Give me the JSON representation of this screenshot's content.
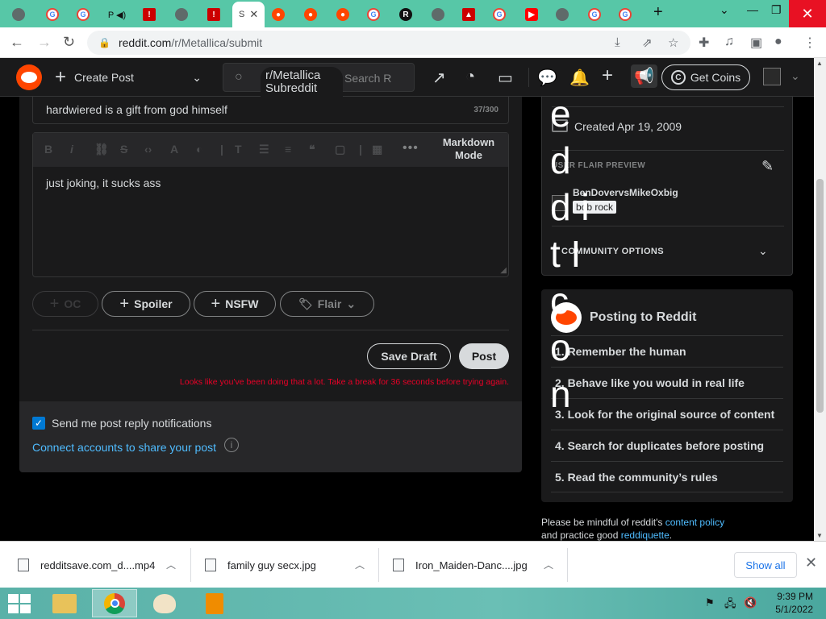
{
  "browser": {
    "active_tab_label": "S",
    "url_host": "reddit.com",
    "url_path": "/r/Metallica/submit",
    "tab_favicons": [
      "chrome-icon",
      "google-icon",
      "google-icon",
      "generic-icon",
      "youtube-dislike-icon",
      "chrome-icon",
      "youtube-dislike-icon",
      "reddit-icon",
      "reddit-icon",
      "reddit-icon",
      "google-icon",
      "rapidsave-icon",
      "chrome-icon",
      "reddit-dl-icon",
      "google-icon",
      "youtube-icon",
      "chrome-icon",
      "google-icon",
      "google-icon"
    ]
  },
  "header": {
    "create_post": "Create Post",
    "subreddit_chip": "r/Metallica",
    "subreddit_icon_alt": "Subreddit Icon",
    "search_placeholder": "Search R",
    "get_coins": "Get Coins"
  },
  "composer": {
    "title_value": "hardwiered is a gift from god himself",
    "title_count": "37/300",
    "markdown_mode": "Markdown Mode",
    "body_text": "just joking, it sucks ass",
    "oc_label": "OC",
    "spoiler_label": "Spoiler",
    "nsfw_label": "NSFW",
    "flair_label": "Flair",
    "save_draft": "Save Draft",
    "post": "Post",
    "error": "Looks like you've been doing that a lot. Take a break for 36 seconds before trying again.",
    "notify_label": "Send me post reply notifications",
    "connect_label": "Connect accounts to share your post"
  },
  "sidebar": {
    "broken_alt": "e d d i t I c o n",
    "created": "Created Apr 19, 2009",
    "user_flair_preview": "USER FLAIR PREVIEW",
    "username": "BenDovervsMikeOxbig",
    "flair": "bob rock",
    "community_options": "COMMUNITY OPTIONS",
    "posting_title": "Posting to Reddit",
    "rules": [
      "1. Remember the human",
      "2. Behave like you would in real life",
      "3. Look for the original source of content",
      "4. Search for duplicates before posting",
      "5. Read the community’s rules"
    ],
    "policy_prefix": "Please be mindful of reddit's",
    "content_policy": "content policy",
    "policy_mid": "and practice good",
    "reddiquette": "reddiquette",
    "policy_end": "."
  },
  "downloads": [
    {
      "name": "redditsave.com_d....mp4"
    },
    {
      "name": "family guy secx.jpg"
    },
    {
      "name": "Iron_Maiden-Danc....jpg"
    }
  ],
  "downloads_show_all": "Show all",
  "taskbar": {
    "time": "9:39 PM",
    "date": "5/1/2022"
  }
}
